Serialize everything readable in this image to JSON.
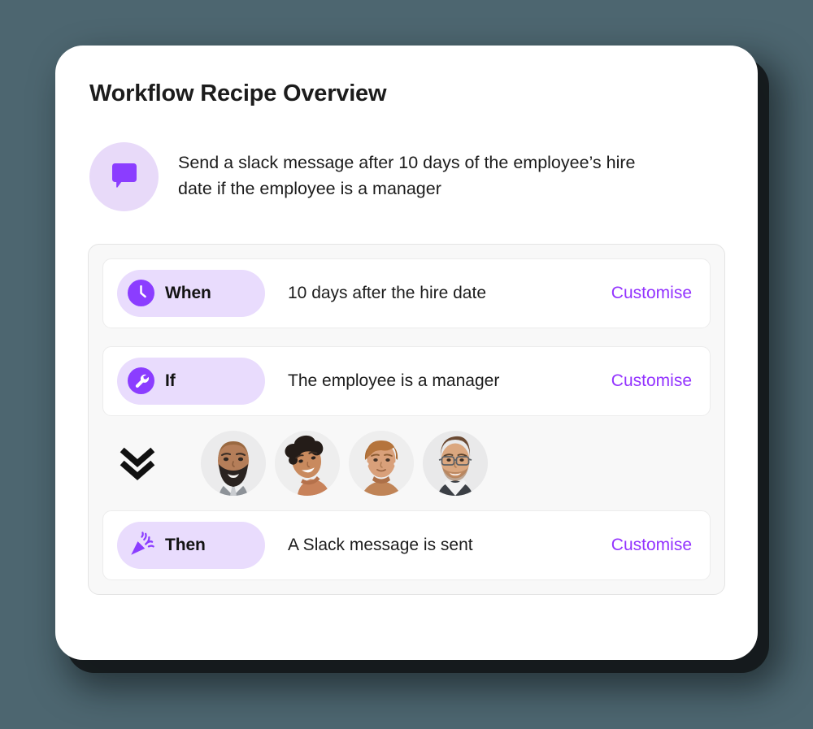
{
  "page": {
    "title": "Workflow Recipe Overview",
    "background_color": "#4d6670",
    "card_color": "#ffffff"
  },
  "summary": {
    "icon": "speech-bubble-icon",
    "icon_color": "#8b3dff",
    "icon_background": "#e8daf9",
    "text": "Send a slack message after 10 days of the employee’s hire date if the employee is a manager"
  },
  "recipe": {
    "accent_color": "#9333ff",
    "pill_background": "#e9dcfd",
    "steps": [
      {
        "label": "When",
        "icon": "clock-icon",
        "description": "10 days after the hire date",
        "action_label": "Customise"
      },
      {
        "label": "If",
        "icon": "wrench-icon",
        "description": "The employee is a manager",
        "action_label": "Customise"
      },
      {
        "label": "Then",
        "icon": "party-popper-icon",
        "description": "A Slack message is sent",
        "action_label": "Customise"
      }
    ],
    "connector": {
      "icon": "double-chevron-down-icon",
      "avatars": [
        {
          "name": "avatar-bald-bearded-man"
        },
        {
          "name": "avatar-curly-haired-woman"
        },
        {
          "name": "avatar-short-hair-woman"
        },
        {
          "name": "avatar-glasses-man"
        }
      ]
    }
  }
}
